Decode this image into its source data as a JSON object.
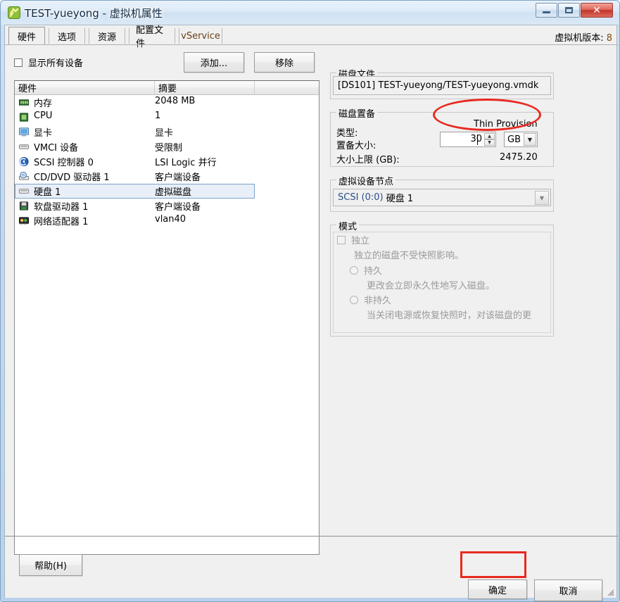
{
  "window": {
    "title": "TEST-yueyong - 虚拟机属性",
    "icon": "vm-icon",
    "controls": {
      "minimize": "minimize-button",
      "maximize": "maximize-button",
      "close": "close-button"
    }
  },
  "tabs": [
    {
      "label": "硬件",
      "active": true
    },
    {
      "label": "选项",
      "active": false
    },
    {
      "label": "资源",
      "active": false
    },
    {
      "label": "配置文件",
      "active": false
    },
    {
      "label": "vService",
      "active": false
    }
  ],
  "vm_version": {
    "label": "虚拟机版本:",
    "value": "8"
  },
  "left": {
    "show_all_devices": {
      "label": "显示所有设备",
      "checked": false
    },
    "add_button": "添加...",
    "remove_button": "移除",
    "columns": [
      "硬件",
      "摘要",
      ""
    ],
    "rows": [
      {
        "icon": "memory-icon",
        "name": "内存",
        "summary": "2048 MB",
        "selected": false
      },
      {
        "icon": "cpu-icon",
        "name": "CPU",
        "summary": "1",
        "selected": false
      },
      {
        "icon": "display-icon",
        "name": "显卡",
        "summary": "显卡",
        "selected": false
      },
      {
        "icon": "device-icon",
        "name": "VMCI 设备",
        "summary": "受限制",
        "selected": false
      },
      {
        "icon": "scsi-icon",
        "name": "SCSI 控制器 0",
        "summary": "LSI Logic 并行",
        "selected": false
      },
      {
        "icon": "cddvd-icon",
        "name": "CD/DVD 驱动器 1",
        "summary": "客户端设备",
        "selected": false
      },
      {
        "icon": "harddisk-icon",
        "name": "硬盘 1",
        "summary": "虚拟磁盘",
        "selected": true
      },
      {
        "icon": "floppy-icon",
        "name": "软盘驱动器 1",
        "summary": "客户端设备",
        "selected": false
      },
      {
        "icon": "network-icon",
        "name": "网络适配器 1",
        "summary": "vlan40",
        "selected": false
      }
    ]
  },
  "right": {
    "disk_file": {
      "legend": "磁盘文件",
      "value": "[DS101] TEST-yueyong/TEST-yueyong.vmdk"
    },
    "disk_provisioning": {
      "legend": "磁盘置备",
      "type_label": "类型:",
      "type_value": "Thin Provision",
      "size_label": "置备大小:",
      "size_value": "30",
      "size_unit": "GB",
      "max_label": "大小上限 (GB):",
      "max_value": "2475.20",
      "spin_up": "▲",
      "spin_down": "▼",
      "unit_arrow": "▼"
    },
    "virtual_device_node": {
      "legend": "虚拟设备节点",
      "value_prefix": "SCSI (0:0)",
      "value_suffix": "硬盘 1",
      "arrow": "▼"
    },
    "mode": {
      "legend": "模式",
      "independent": {
        "label": "独立",
        "checked": false
      },
      "independent_desc": "独立的磁盘不受快照影响。",
      "persistent": {
        "label": "持久",
        "selected": false
      },
      "persistent_desc": "更改会立即永久性地写入磁盘。",
      "nonpersistent": {
        "label": "非持久",
        "selected": false
      },
      "nonpersistent_desc": "当关闭电源或恢复快照时，对该磁盘的更"
    }
  },
  "footer": {
    "help": "帮助(H)",
    "help_mnemonic": "H",
    "ok": "确定",
    "cancel": "取消"
  },
  "annotations": {
    "highlight_color": "#e8291f",
    "size_field_ellipse": "size-field-highlight",
    "ok_button_box": "ok-button-highlight"
  }
}
